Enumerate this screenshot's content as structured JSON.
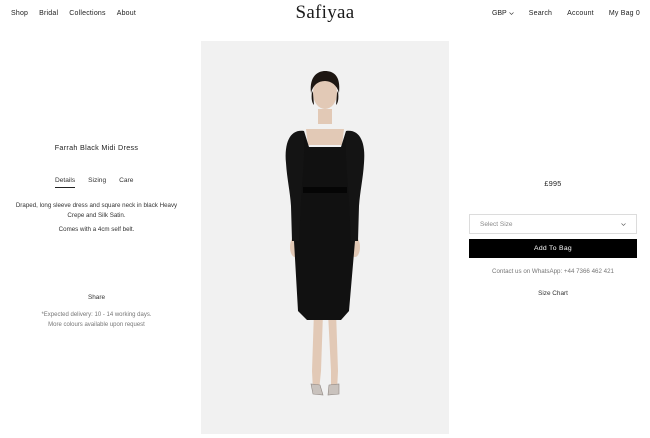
{
  "header": {
    "nav_left": [
      "Shop",
      "Bridal",
      "Collections",
      "About"
    ],
    "logo": "Safiyaa",
    "currency": "GBP",
    "search": "Search",
    "account": "Account",
    "bag": "My Bag 0"
  },
  "product": {
    "title": "Farrah Black Midi Dress",
    "tabs": [
      {
        "label": "Details",
        "active": true
      },
      {
        "label": "Sizing",
        "active": false
      },
      {
        "label": "Care",
        "active": false
      }
    ],
    "description": "Draped, long sleeve dress and square neck in black Heavy Crepe and Silk Satin.",
    "belt_note": "Comes with a 4cm self belt.",
    "share": "Share",
    "delivery_line1": "*Expected delivery: 10 - 14 working days.",
    "delivery_line2": "More colours available upon request",
    "price": "£995",
    "size_placeholder": "Select Size",
    "add_to_bag": "Add To Bag",
    "contact": "Contact us on WhatsApp: +44 7366 462 421",
    "size_chart": "Size Chart"
  },
  "colors": {
    "hero_bg": "#f1f1f1",
    "button_bg": "#000000",
    "dress": "#111111"
  }
}
